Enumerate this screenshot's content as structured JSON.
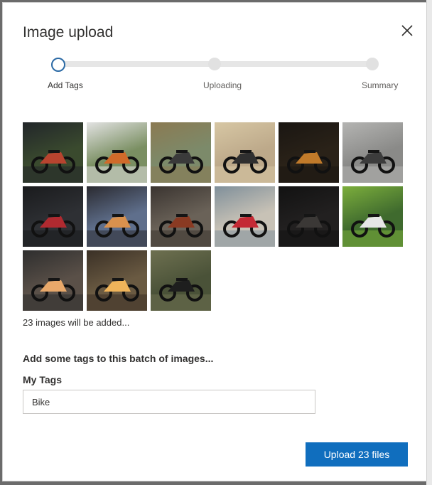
{
  "dialog": {
    "title": "Image upload",
    "close_icon": "close-icon"
  },
  "stepper": {
    "steps": [
      {
        "label": "Add Tags",
        "state": "current"
      },
      {
        "label": "Uploading",
        "state": "pending"
      },
      {
        "label": "Summary",
        "state": "pending"
      }
    ]
  },
  "images": [
    {
      "name": "thumbnail-1",
      "bg": "#3a4a2e",
      "accent": "#b8442f",
      "fg": "#22262a"
    },
    {
      "name": "thumbnail-2",
      "bg": "#7a8f62",
      "accent": "#d06a2a",
      "fg": "#e2e2e2"
    },
    {
      "name": "thumbnail-3",
      "bg": "#7c8a6a",
      "accent": "#3a3a3a",
      "fg": "#8b7a52"
    },
    {
      "name": "thumbnail-4",
      "bg": "#bda98a",
      "accent": "#2f2f2f",
      "fg": "#d7c7a4"
    },
    {
      "name": "thumbnail-5",
      "bg": "#2a2218",
      "accent": "#c07a2a",
      "fg": "#1a1612"
    },
    {
      "name": "thumbnail-6",
      "bg": "#8a8a88",
      "accent": "#3c3c3c",
      "fg": "#b4b4b2"
    },
    {
      "name": "thumbnail-7",
      "bg": "#2e3034",
      "accent": "#b02a30",
      "fg": "#1a1b1d"
    },
    {
      "name": "thumbnail-8",
      "bg": "#5f6f8c",
      "accent": "#d9914e",
      "fg": "#2a2a30"
    },
    {
      "name": "thumbnail-9",
      "bg": "#6a6258",
      "accent": "#8a3a22",
      "fg": "#3a3430"
    },
    {
      "name": "thumbnail-10",
      "bg": "#c8c2b6",
      "accent": "#c42a34",
      "fg": "#7f8f9a"
    },
    {
      "name": "thumbnail-11",
      "bg": "#222020",
      "accent": "#3b3836",
      "fg": "#121212"
    },
    {
      "name": "thumbnail-12",
      "bg": "#3f6a2e",
      "accent": "#e6e6e6",
      "fg": "#7cae3c"
    },
    {
      "name": "thumbnail-13",
      "bg": "#5a5048",
      "accent": "#e8a86a",
      "fg": "#2e2e2e"
    },
    {
      "name": "thumbnail-14",
      "bg": "#6a5a42",
      "accent": "#f0b45a",
      "fg": "#3a3026"
    },
    {
      "name": "thumbnail-15",
      "bg": "#4a5238",
      "accent": "#1e1e1e",
      "fg": "#6e7050"
    }
  ],
  "summary": {
    "count_text": "23 images will be added..."
  },
  "tags": {
    "heading": "Add some tags to this batch of images...",
    "label": "My Tags",
    "value": "Bike"
  },
  "actions": {
    "upload_label": "Upload 23 files"
  },
  "colors": {
    "primary": "#106ebe",
    "active_step": "#2b6aa5"
  }
}
